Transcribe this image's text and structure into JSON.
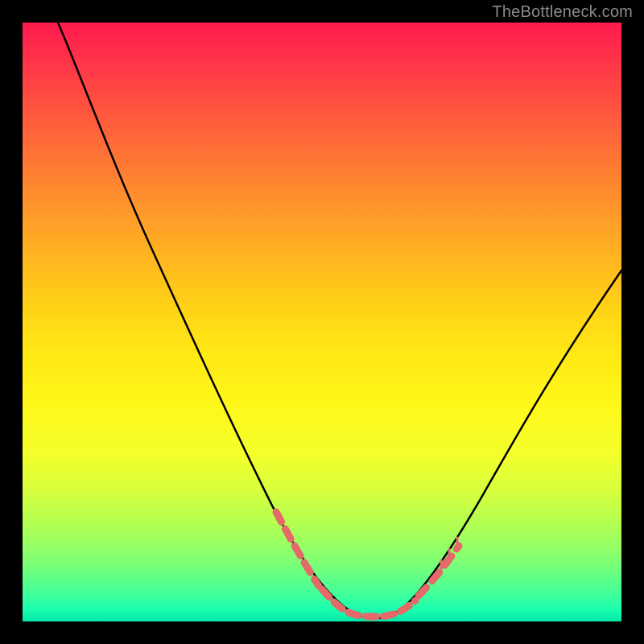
{
  "watermark": "TheBottleneck.com",
  "chart_data": {
    "type": "line",
    "title": "",
    "xlabel": "",
    "ylabel": "",
    "x_range": [
      0,
      100
    ],
    "y_range": [
      0,
      100
    ],
    "series": [
      {
        "name": "curve",
        "x": [
          6,
          10,
          15,
          20,
          25,
          30,
          35,
          40,
          45,
          48,
          50,
          52,
          54,
          56,
          58,
          60,
          62,
          65,
          68,
          72,
          76,
          80,
          85,
          90,
          95,
          100
        ],
        "y": [
          100,
          91,
          80,
          70,
          60,
          50,
          40,
          30,
          20,
          14,
          10,
          6,
          3,
          1.5,
          1,
          1,
          1.5,
          3,
          6,
          11,
          17,
          24,
          32,
          41,
          50,
          58
        ]
      }
    ],
    "red_segments": {
      "left": {
        "x_start": 44,
        "x_end": 50,
        "y_start": 22,
        "y_end": 9
      },
      "floor": {
        "x_start": 50,
        "x_end": 64,
        "y_around": 1.2
      },
      "right": {
        "x_start": 64,
        "x_end": 70,
        "y_start": 4,
        "y_end": 9
      }
    },
    "colors": {
      "curve": "#000000",
      "dashes": "#e46a6a",
      "gradient_top": "#ff1a4d",
      "gradient_bottom": "#00e8a8"
    }
  }
}
